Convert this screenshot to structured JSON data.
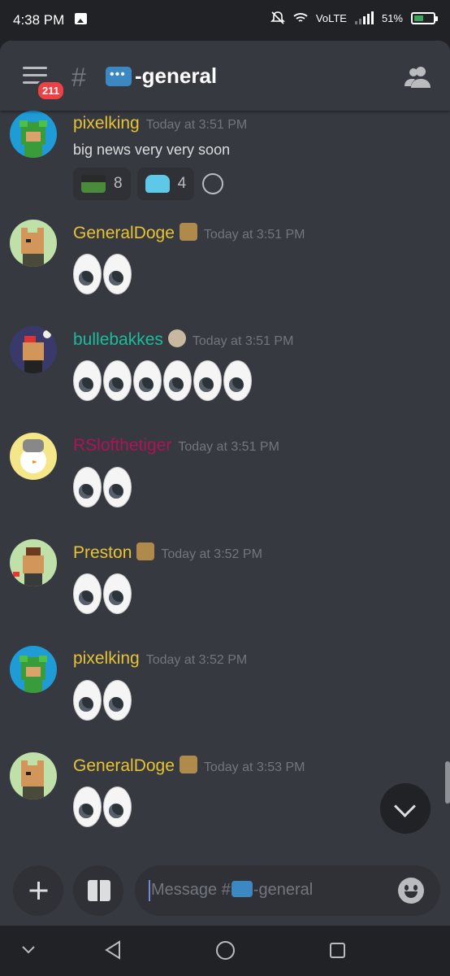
{
  "status_bar": {
    "time": "4:38 PM",
    "network": "VoLTE",
    "battery": "51%",
    "battery_level": 0.51
  },
  "header": {
    "unread_badge": "211",
    "hash": "#",
    "channel_name": "-general",
    "channel_icon": "speech-balloon-icon"
  },
  "messages": [
    {
      "user": "pixelking",
      "user_color": "#e8c333",
      "time": "Today at 3:51 PM",
      "text": "big news very very soon",
      "reactions": [
        {
          "emoji": "pepe-glasses-emoji",
          "count": "8"
        },
        {
          "emoji": "blue-doge-emoji",
          "count": "4"
        }
      ],
      "eyes": 0
    },
    {
      "user": "GeneralDoge",
      "user_color": "#e8c333",
      "time": "Today at 3:51 PM",
      "role_icon": "doge-hat-icon",
      "eyes": 2
    },
    {
      "user": "bullebakkes",
      "user_color": "#1abc9c",
      "time": "Today at 3:51 PM",
      "role_icon": "paw-icon",
      "eyes": 6
    },
    {
      "user": "RSlofthetiger",
      "user_color": "#ad1457",
      "time": "Today at 3:51 PM",
      "eyes": 2
    },
    {
      "user": "Preston",
      "user_color": "#e8c333",
      "time": "Today at 3:52 PM",
      "role_icon": "doge-hat-icon",
      "eyes": 2
    },
    {
      "user": "pixelking",
      "user_color": "#e8c333",
      "time": "Today at 3:52 PM",
      "eyes": 2
    },
    {
      "user": "GeneralDoge",
      "user_color": "#e8c333",
      "time": "Today at 3:53 PM",
      "role_icon": "doge-hat-icon",
      "eyes": 2
    }
  ],
  "composer": {
    "placeholder": "Message #",
    "placeholder_channel": "-general"
  },
  "nav": {
    "icons": [
      "chevron-down-icon",
      "back-triangle-icon",
      "home-circle-icon",
      "recents-square-icon"
    ]
  }
}
